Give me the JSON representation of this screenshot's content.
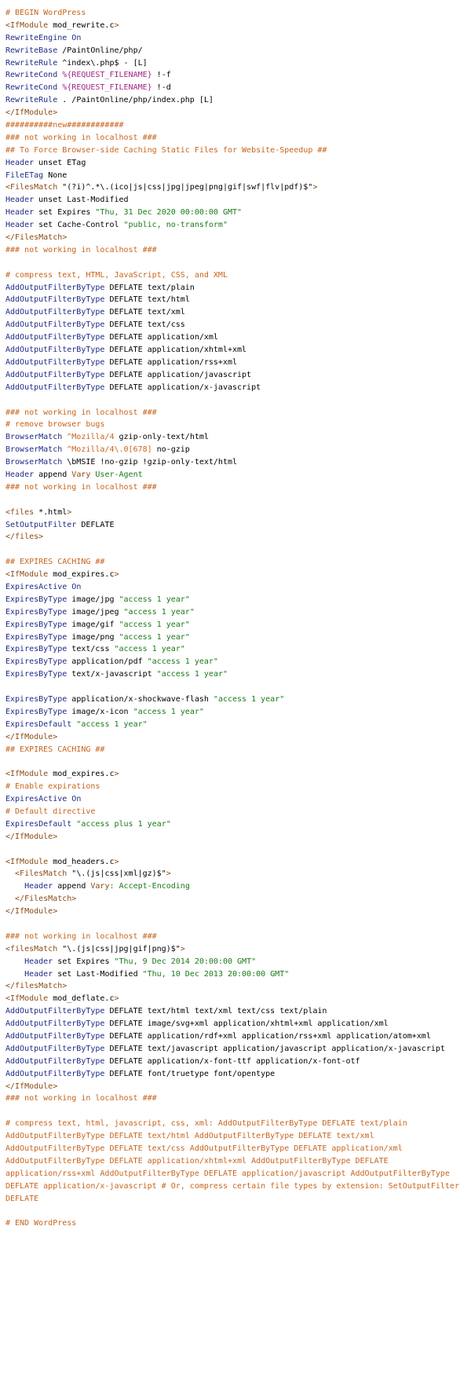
{
  "colors": {
    "comment": "#c8641c",
    "directive": "#1e2a86",
    "string": "#1a7a1a",
    "variable": "#a3258a",
    "tag": "#8a4a14",
    "plain": "#000000"
  },
  "lines": [
    [
      {
        "t": "# BEGIN WordPress",
        "c": "comment"
      }
    ],
    [
      {
        "t": "<IfModule",
        "c": "tag"
      },
      {
        "t": " mod_rewrite.c",
        "c": "plain"
      },
      {
        "t": ">",
        "c": "tag"
      }
    ],
    [
      {
        "t": "RewriteEngine",
        "c": "dir"
      },
      {
        "t": " On",
        "c": "dir"
      }
    ],
    [
      {
        "t": "RewriteBase",
        "c": "dir"
      },
      {
        "t": " /PaintOnline/php/",
        "c": "plain"
      }
    ],
    [
      {
        "t": "RewriteRule",
        "c": "dir"
      },
      {
        "t": " ^index\\.php$ - [L]",
        "c": "plain"
      }
    ],
    [
      {
        "t": "RewriteCond",
        "c": "dir"
      },
      {
        "t": " %{REQUEST_FILENAME}",
        "c": "var"
      },
      {
        "t": " !-f",
        "c": "plain"
      }
    ],
    [
      {
        "t": "RewriteCond",
        "c": "dir"
      },
      {
        "t": " %{REQUEST_FILENAME}",
        "c": "var"
      },
      {
        "t": " !-d",
        "c": "plain"
      }
    ],
    [
      {
        "t": "RewriteRule",
        "c": "dir"
      },
      {
        "t": " . /PaintOnline/php/index.php [L]",
        "c": "plain"
      }
    ],
    [
      {
        "t": "</IfModule>",
        "c": "tag"
      }
    ],
    [
      {
        "t": "##########new############",
        "c": "comment"
      }
    ],
    [
      {
        "t": "### not working in localhost ###",
        "c": "comment"
      }
    ],
    [
      {
        "t": "## To Force Browser-side Caching Static Files for Website-Speedup ##",
        "c": "comment"
      }
    ],
    [
      {
        "t": "Header",
        "c": "dir"
      },
      {
        "t": " unset ETag",
        "c": "plain"
      }
    ],
    [
      {
        "t": "FileETag",
        "c": "dir"
      },
      {
        "t": " None",
        "c": "plain"
      }
    ],
    [
      {
        "t": "<FilesMatch",
        "c": "tag"
      },
      {
        "t": " \"(?i)^.*\\.(ico|js|css|jpg|jpeg|png|gif|swf|flv|pdf)$\"",
        "c": "plain"
      },
      {
        "t": ">",
        "c": "tag"
      }
    ],
    [
      {
        "t": "Header",
        "c": "dir"
      },
      {
        "t": " unset Last-Modified",
        "c": "plain"
      }
    ],
    [
      {
        "t": "Header",
        "c": "dir"
      },
      {
        "t": " set Expires ",
        "c": "plain"
      },
      {
        "t": "\"Thu, 31 Dec 2020 00:00:00 GMT\"",
        "c": "string"
      }
    ],
    [
      {
        "t": "Header",
        "c": "dir"
      },
      {
        "t": " set Cache-Control ",
        "c": "plain"
      },
      {
        "t": "\"public, no-transform\"",
        "c": "string"
      }
    ],
    [
      {
        "t": "</FilesMatch>",
        "c": "tag"
      }
    ],
    [
      {
        "t": "### not working in localhost ###",
        "c": "comment"
      }
    ],
    [],
    [
      {
        "t": "# compress text, HTML, JavaScript, CSS, and XML",
        "c": "comment"
      }
    ],
    [
      {
        "t": "AddOutputFilterByType",
        "c": "dir"
      },
      {
        "t": " DEFLATE text/plain",
        "c": "plain"
      }
    ],
    [
      {
        "t": "AddOutputFilterByType",
        "c": "dir"
      },
      {
        "t": " DEFLATE text/html",
        "c": "plain"
      }
    ],
    [
      {
        "t": "AddOutputFilterByType",
        "c": "dir"
      },
      {
        "t": " DEFLATE text/xml",
        "c": "plain"
      }
    ],
    [
      {
        "t": "AddOutputFilterByType",
        "c": "dir"
      },
      {
        "t": " DEFLATE text/css",
        "c": "plain"
      }
    ],
    [
      {
        "t": "AddOutputFilterByType",
        "c": "dir"
      },
      {
        "t": " DEFLATE application/xml",
        "c": "plain"
      }
    ],
    [
      {
        "t": "AddOutputFilterByType",
        "c": "dir"
      },
      {
        "t": " DEFLATE application/xhtml+xml",
        "c": "plain"
      }
    ],
    [
      {
        "t": "AddOutputFilterByType",
        "c": "dir"
      },
      {
        "t": " DEFLATE application/rss+xml",
        "c": "plain"
      }
    ],
    [
      {
        "t": "AddOutputFilterByType",
        "c": "dir"
      },
      {
        "t": " DEFLATE application/javascript",
        "c": "plain"
      }
    ],
    [
      {
        "t": "AddOutputFilterByType",
        "c": "dir"
      },
      {
        "t": " DEFLATE application/x-javascript",
        "c": "plain"
      }
    ],
    [],
    [
      {
        "t": "### not working in localhost ###",
        "c": "comment"
      }
    ],
    [
      {
        "t": "# remove browser bugs",
        "c": "comment"
      }
    ],
    [
      {
        "t": "BrowserMatch",
        "c": "dir"
      },
      {
        "t": " ^Mozilla/4",
        "c": "comment"
      },
      {
        "t": " gzip-only-text/html",
        "c": "plain"
      }
    ],
    [
      {
        "t": "BrowserMatch",
        "c": "dir"
      },
      {
        "t": " ^Mozilla/4\\.0[678]",
        "c": "comment"
      },
      {
        "t": " no-gzip",
        "c": "plain"
      }
    ],
    [
      {
        "t": "BrowserMatch",
        "c": "dir"
      },
      {
        "t": " \\bMSIE !no-gzip !gzip-only-text/html",
        "c": "plain"
      }
    ],
    [
      {
        "t": "Header",
        "c": "dir"
      },
      {
        "t": " append ",
        "c": "plain"
      },
      {
        "t": "Vary",
        "c": "tag"
      },
      {
        "t": " User-Agent",
        "c": "string"
      }
    ],
    [
      {
        "t": "### not working in localhost ###",
        "c": "comment"
      }
    ],
    [],
    [
      {
        "t": "<files",
        "c": "tag"
      },
      {
        "t": " *.html",
        "c": "plain"
      },
      {
        "t": ">",
        "c": "tag"
      }
    ],
    [
      {
        "t": "SetOutputFilter",
        "c": "dir"
      },
      {
        "t": " DEFLATE",
        "c": "plain"
      }
    ],
    [
      {
        "t": "</files>",
        "c": "tag"
      }
    ],
    [],
    [
      {
        "t": "## EXPIRES CACHING ##",
        "c": "comment"
      }
    ],
    [
      {
        "t": "<IfModule",
        "c": "tag"
      },
      {
        "t": " mod_expires.c",
        "c": "plain"
      },
      {
        "t": ">",
        "c": "tag"
      }
    ],
    [
      {
        "t": "ExpiresActive",
        "c": "dir"
      },
      {
        "t": " On",
        "c": "dir"
      }
    ],
    [
      {
        "t": "ExpiresByType",
        "c": "dir"
      },
      {
        "t": " image/jpg ",
        "c": "plain"
      },
      {
        "t": "\"access 1 year\"",
        "c": "string"
      }
    ],
    [
      {
        "t": "ExpiresByType",
        "c": "dir"
      },
      {
        "t": " image/jpeg ",
        "c": "plain"
      },
      {
        "t": "\"access 1 year\"",
        "c": "string"
      }
    ],
    [
      {
        "t": "ExpiresByType",
        "c": "dir"
      },
      {
        "t": " image/gif ",
        "c": "plain"
      },
      {
        "t": "\"access 1 year\"",
        "c": "string"
      }
    ],
    [
      {
        "t": "ExpiresByType",
        "c": "dir"
      },
      {
        "t": " image/png ",
        "c": "plain"
      },
      {
        "t": "\"access 1 year\"",
        "c": "string"
      }
    ],
    [
      {
        "t": "ExpiresByType",
        "c": "dir"
      },
      {
        "t": " text/css ",
        "c": "plain"
      },
      {
        "t": "\"access 1 year\"",
        "c": "string"
      }
    ],
    [
      {
        "t": "ExpiresByType",
        "c": "dir"
      },
      {
        "t": " application/pdf ",
        "c": "plain"
      },
      {
        "t": "\"access 1 year\"",
        "c": "string"
      }
    ],
    [
      {
        "t": "ExpiresByType",
        "c": "dir"
      },
      {
        "t": " text/x-javascript ",
        "c": "plain"
      },
      {
        "t": "\"access 1 year\"",
        "c": "string"
      }
    ],
    [],
    [
      {
        "t": "ExpiresByType",
        "c": "dir"
      },
      {
        "t": " application/x-shockwave-flash ",
        "c": "plain"
      },
      {
        "t": "\"access 1 year\"",
        "c": "string"
      }
    ],
    [
      {
        "t": "ExpiresByType",
        "c": "dir"
      },
      {
        "t": " image/x-icon ",
        "c": "plain"
      },
      {
        "t": "\"access 1 year\"",
        "c": "string"
      }
    ],
    [
      {
        "t": "ExpiresDefault",
        "c": "dir"
      },
      {
        "t": " ",
        "c": "plain"
      },
      {
        "t": "\"access 1 year\"",
        "c": "string"
      }
    ],
    [
      {
        "t": "</IfModule>",
        "c": "tag"
      }
    ],
    [
      {
        "t": "## EXPIRES CACHING ##",
        "c": "comment"
      }
    ],
    [],
    [
      {
        "t": "<IfModule",
        "c": "tag"
      },
      {
        "t": " mod_expires.c",
        "c": "plain"
      },
      {
        "t": ">",
        "c": "tag"
      }
    ],
    [
      {
        "t": "# Enable expirations",
        "c": "comment"
      }
    ],
    [
      {
        "t": "ExpiresActive",
        "c": "dir"
      },
      {
        "t": " On",
        "c": "dir"
      }
    ],
    [
      {
        "t": "# Default directive",
        "c": "comment"
      }
    ],
    [
      {
        "t": "ExpiresDefault",
        "c": "dir"
      },
      {
        "t": " ",
        "c": "plain"
      },
      {
        "t": "\"access plus 1 year\"",
        "c": "string"
      }
    ],
    [
      {
        "t": "</IfModule>",
        "c": "tag"
      }
    ],
    [],
    [
      {
        "t": "<IfModule",
        "c": "tag"
      },
      {
        "t": " mod_headers.c",
        "c": "plain"
      },
      {
        "t": ">",
        "c": "tag"
      }
    ],
    [
      {
        "t": "  <FilesMatch",
        "c": "tag"
      },
      {
        "t": " \"\\.(js|css|xml|gz)$\"",
        "c": "plain"
      },
      {
        "t": ">",
        "c": "tag"
      }
    ],
    [
      {
        "t": "    Header",
        "c": "dir"
      },
      {
        "t": " append ",
        "c": "plain"
      },
      {
        "t": "Vary",
        "c": "tag"
      },
      {
        "t": ": Accept-Encoding",
        "c": "string"
      }
    ],
    [
      {
        "t": "  </FilesMatch>",
        "c": "tag"
      }
    ],
    [
      {
        "t": "</IfModule>",
        "c": "tag"
      }
    ],
    [],
    [
      {
        "t": "### not working in localhost ###",
        "c": "comment"
      }
    ],
    [
      {
        "t": "<filesMatch",
        "c": "tag"
      },
      {
        "t": " \"\\.(js|css|jpg|gif|png)$\"",
        "c": "plain"
      },
      {
        "t": ">",
        "c": "tag"
      }
    ],
    [
      {
        "t": "    Header",
        "c": "dir"
      },
      {
        "t": " set Expires ",
        "c": "plain"
      },
      {
        "t": "\"Thu, 9 Dec 2014 20:00:00 GMT\"",
        "c": "string"
      }
    ],
    [
      {
        "t": "    Header",
        "c": "dir"
      },
      {
        "t": " set Last-Modified ",
        "c": "plain"
      },
      {
        "t": "\"Thu, 10 Dec 2013 20:00:00 GMT\"",
        "c": "string"
      }
    ],
    [
      {
        "t": "</filesMatch>",
        "c": "tag"
      }
    ],
    [
      {
        "t": "<IfModule",
        "c": "tag"
      },
      {
        "t": " mod_deflate.c",
        "c": "plain"
      },
      {
        "t": ">",
        "c": "tag"
      }
    ],
    [
      {
        "t": "AddOutputFilterByType",
        "c": "dir"
      },
      {
        "t": " DEFLATE text/html text/xml text/css text/plain",
        "c": "plain"
      }
    ],
    [
      {
        "t": "AddOutputFilterByType",
        "c": "dir"
      },
      {
        "t": " DEFLATE image/svg+xml application/xhtml+xml application/xml",
        "c": "plain"
      }
    ],
    [
      {
        "t": "AddOutputFilterByType",
        "c": "dir"
      },
      {
        "t": " DEFLATE application/rdf+xml application/rss+xml application/atom+xml",
        "c": "plain"
      }
    ],
    [
      {
        "t": "AddOutputFilterByType",
        "c": "dir"
      },
      {
        "t": " DEFLATE text/javascript application/javascript application/x-javascript",
        "c": "plain"
      }
    ],
    [
      {
        "t": "AddOutputFilterByType",
        "c": "dir"
      },
      {
        "t": " DEFLATE application/x-font-ttf application/x-font-otf",
        "c": "plain"
      }
    ],
    [
      {
        "t": "AddOutputFilterByType",
        "c": "dir"
      },
      {
        "t": " DEFLATE font/truetype font/opentype",
        "c": "plain"
      }
    ],
    [
      {
        "t": "</IfModule>",
        "c": "tag"
      }
    ],
    [
      {
        "t": "### not working in localhost ###",
        "c": "comment"
      }
    ],
    [],
    [
      {
        "t": "# compress text, html, javascript, css, xml: AddOutputFilterByType DEFLATE text/plain",
        "c": "comment"
      }
    ],
    [
      {
        "t": "AddOutputFilterByType DEFLATE text/html AddOutputFilterByType DEFLATE text/xml",
        "c": "comment"
      }
    ],
    [
      {
        "t": "AddOutputFilterByType DEFLATE text/css AddOutputFilterByType DEFLATE application/xml",
        "c": "comment"
      }
    ],
    [
      {
        "t": "AddOutputFilterByType DEFLATE application/xhtml+xml AddOutputFilterByType DEFLATE",
        "c": "comment"
      }
    ],
    [
      {
        "t": "application/rss+xml AddOutputFilterByType DEFLATE application/javascript AddOutputFilterByType",
        "c": "comment"
      }
    ],
    [
      {
        "t": "DEFLATE application/x-javascript # Or, compress certain file types by extension: SetOutputFilter",
        "c": "comment"
      }
    ],
    [
      {
        "t": "DEFLATE",
        "c": "comment"
      }
    ],
    [],
    [
      {
        "t": "# END WordPress",
        "c": "comment"
      }
    ]
  ]
}
